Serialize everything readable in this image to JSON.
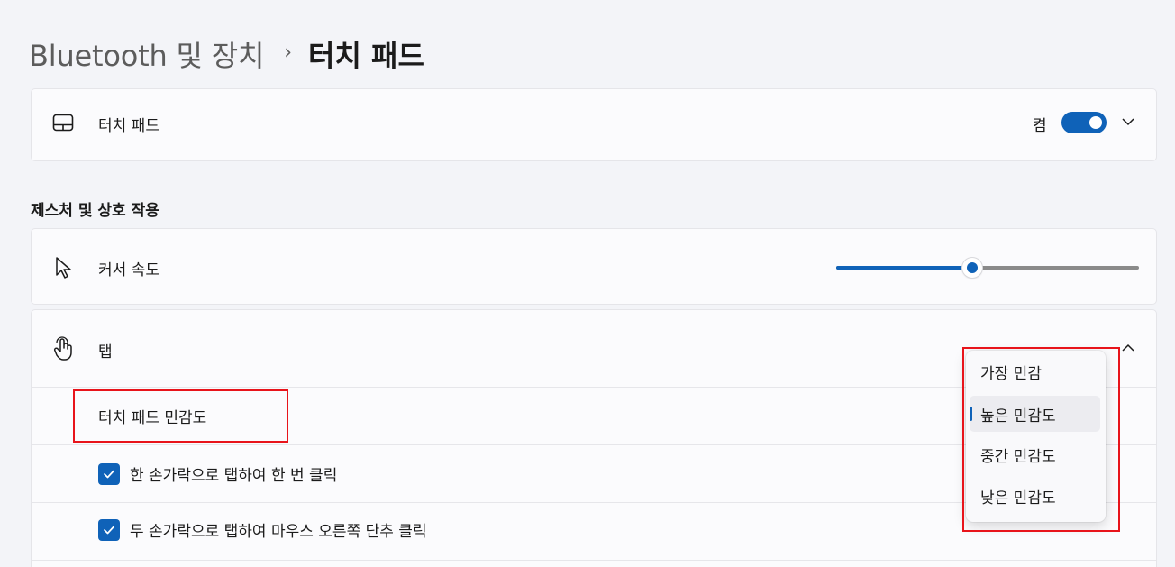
{
  "breadcrumb": {
    "parent": "Bluetooth 및 장치",
    "separator": "›",
    "current": "터치 패드"
  },
  "touchpad_card": {
    "label": "터치 패드",
    "icon": "touchpad-icon",
    "toggle_state_label": "켬",
    "toggle_on": true,
    "expand_icon": "chevron-down-icon"
  },
  "gestures_section": {
    "title": "제스처 및 상호 작용"
  },
  "cursor_speed": {
    "label": "커서 속도",
    "icon": "cursor-icon",
    "slider_fraction": 0.45
  },
  "tap": {
    "label": "탭",
    "icon": "tap-hand-icon",
    "collapse_icon": "chevron-up-icon",
    "sensitivity_label": "터치 패드 민감도",
    "options": [
      {
        "label": "한 손가락으로 탭하여 한 번 클릭",
        "checked": true
      },
      {
        "label": "두 손가락으로 탭하여 마우스 오른쪽 단추 클릭",
        "checked": true
      }
    ]
  },
  "sensitivity_menu": {
    "items": [
      "가장 민감",
      "높은 민감도",
      "중간 민감도",
      "낮은 민감도"
    ],
    "selected_index": 1
  },
  "colors": {
    "accent": "#0f62b8",
    "annotation": "#e8141b",
    "background": "#f3f4f8",
    "card": "#fbfbfd"
  }
}
